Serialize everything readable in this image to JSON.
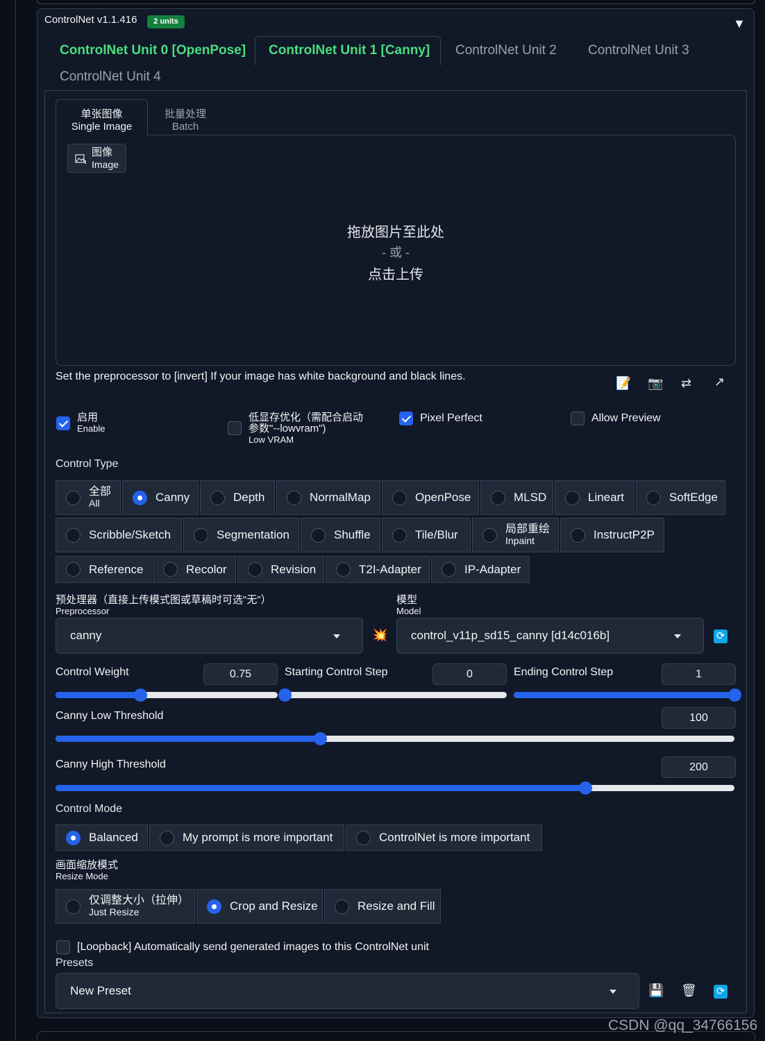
{
  "header": {
    "title": "ControlNet v1.1.416",
    "badge": "2 units",
    "collapse_glyph": "▼"
  },
  "unit_tabs": [
    "ControlNet Unit 0 [OpenPose]",
    "ControlNet Unit 1 [Canny]",
    "ControlNet Unit 2",
    "ControlNet Unit 3",
    "ControlNet Unit 4"
  ],
  "image_tabs": {
    "single_cn": "单张图像",
    "single_en": "Single Image",
    "batch_cn": "批量处理",
    "batch_en": "Batch"
  },
  "image_label": {
    "cn": "图像",
    "en": "Image"
  },
  "drop": {
    "line1": "拖放图片至此处",
    "line2": "- 或 -",
    "line3": "点击上传"
  },
  "hint": "Set the preprocessor to [invert] If your image has white background and black lines.",
  "toolbar_icons": [
    "edit-icon",
    "camera-icon",
    "swap-icon",
    "send-dimensions-icon"
  ],
  "checks": {
    "enable_cn": "启用",
    "enable_en": "Enable",
    "enable_on": true,
    "lowvram_cn1": "低显存优化（需配合启动",
    "lowvram_cn2": "参数\"--lowvram\")",
    "lowvram_en": "Low VRAM",
    "lowvram_on": false,
    "pixel_perfect": "Pixel Perfect",
    "pixel_on": true,
    "allow_preview": "Allow Preview",
    "preview_on": false
  },
  "control_type": {
    "title": "Control Type",
    "all_cn": "全部",
    "all_en": "All",
    "items": [
      "Canny",
      "Depth",
      "NormalMap",
      "OpenPose",
      "MLSD",
      "Lineart",
      "SoftEdge",
      "Scribble/Sketch",
      "Segmentation",
      "Shuffle",
      "Tile/Blur",
      "InstructP2P",
      "Reference",
      "Recolor",
      "Revision",
      "T2I-Adapter",
      "IP-Adapter"
    ],
    "inpaint_cn": "局部重绘",
    "inpaint_en": "Inpaint",
    "selected": "Canny"
  },
  "preprocessor": {
    "label_cn": "预处理器（直接上传模式图或草稿时可选\"无\"）",
    "label_en": "Preprocessor",
    "value": "canny"
  },
  "model": {
    "label_cn": "模型",
    "label_en": "Model",
    "value": "control_v11p_sd15_canny [d14c016b]"
  },
  "sliders": {
    "weight": {
      "label": "Control Weight",
      "value": "0.75",
      "fraction": 0.38
    },
    "start": {
      "label": "Starting Control Step",
      "value": "0",
      "fraction": 0.0
    },
    "end": {
      "label": "Ending Control Step",
      "value": "1",
      "fraction": 1.0
    },
    "low": {
      "label": "Canny Low Threshold",
      "value": "100",
      "fraction": 0.39
    },
    "high": {
      "label": "Canny High Threshold",
      "value": "200",
      "fraction": 0.78
    }
  },
  "control_mode": {
    "title": "Control Mode",
    "options": [
      "Balanced",
      "My prompt is more important",
      "ControlNet is more important"
    ],
    "selected": "Balanced"
  },
  "resize_mode": {
    "title_cn": "画面缩放模式",
    "title_en": "Resize Mode",
    "just_cn": "仅调整大小（拉伸）",
    "just_en": "Just Resize",
    "crop": "Crop and Resize",
    "fill": "Resize and Fill",
    "selected": "Crop and Resize"
  },
  "loopback": "[Loopback] Automatically send generated images to this ControlNet unit",
  "presets": {
    "title": "Presets",
    "value": "New Preset"
  },
  "watermark": "CSDN @qq_34766156",
  "colors": {
    "accent": "#2563eb",
    "green_tab": "#4ade80",
    "badge": "#15803d",
    "panel": "#111827"
  }
}
